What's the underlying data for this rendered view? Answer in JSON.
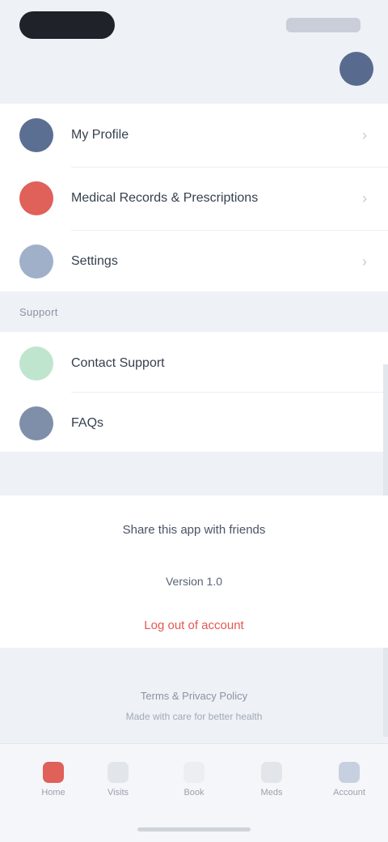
{
  "status_bar": {
    "time": "",
    "indicators": ""
  },
  "profile": {
    "avatar_color": "#586b8f"
  },
  "menu_group_1": [
    {
      "icon": "user-icon",
      "color": "#5b6f93",
      "label": "My Profile"
    },
    {
      "icon": "health-record-icon",
      "color": "#e0605a",
      "label": "Medical Records & Prescriptions"
    },
    {
      "icon": "settings-icon",
      "color": "#9fb0c8",
      "label": "Settings"
    }
  ],
  "section_header": "Support",
  "menu_group_2": [
    {
      "icon": "chat-icon",
      "color": "#bfe5cf",
      "label": "Contact Support"
    },
    {
      "icon": "help-icon",
      "color": "#7f8faa",
      "label": "FAQs"
    }
  ],
  "promo": {
    "title": "Share this app with friends",
    "version": "Version 1.0",
    "logout": "Log out of account"
  },
  "footer": {
    "text": "Terms & Privacy Policy",
    "sub": "Made with care for better health"
  },
  "tabs": [
    {
      "icon": "home-icon",
      "label": "Home",
      "color": "#e0605a"
    },
    {
      "icon": "calendar-icon",
      "label": "Visits",
      "color": "#e2e5ea"
    },
    {
      "icon": "plus-icon",
      "label": "Book",
      "color": "#eceef2"
    },
    {
      "icon": "pill-icon",
      "label": "Meds",
      "color": "#e2e5ea"
    },
    {
      "icon": "account-icon",
      "label": "Account",
      "color": "#c7d0e0"
    }
  ]
}
